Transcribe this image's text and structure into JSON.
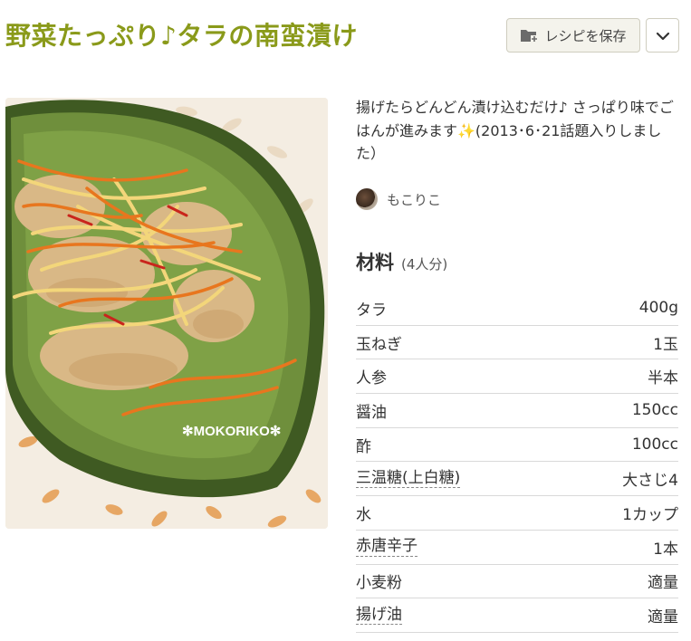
{
  "recipe": {
    "title": "野菜たっぷり♪タラの南蛮漬け",
    "save_label": "レシピを保存",
    "description": "揚げたらどんどん漬け込むだけ♪ さっぱり味でごはんが進みます✨(2013･6･21話題入りしました）",
    "author": "もこりこ",
    "photo_watermark": "✻MOKORIKO✻",
    "ingredients_heading": "材料",
    "servings": "(4人分)",
    "ingredients": [
      {
        "name": "タラ",
        "qty": "400g",
        "link": false
      },
      {
        "name": "玉ねぎ",
        "qty": "1玉",
        "link": false
      },
      {
        "name": "人参",
        "qty": "半本",
        "link": false
      },
      {
        "name": "醤油",
        "qty": "150cc",
        "link": false
      },
      {
        "name": "酢",
        "qty": "100cc",
        "link": false
      },
      {
        "name": "三温糖(上白糖)",
        "qty": "大さじ4",
        "link": true
      },
      {
        "name": "水",
        "qty": "1カップ",
        "link": false
      },
      {
        "name": "赤唐辛子",
        "qty": "1本",
        "link": true
      },
      {
        "name": "小麦粉",
        "qty": "適量",
        "link": false
      },
      {
        "name": "揚げ油",
        "qty": "適量",
        "link": true
      }
    ]
  },
  "colors": {
    "title": "#8a9a1a",
    "plate_green": "#4e6b2a",
    "carrot": "#e8761e"
  },
  "icons": {
    "save": "folder-plus-icon",
    "menu": "chevron-down-icon"
  }
}
